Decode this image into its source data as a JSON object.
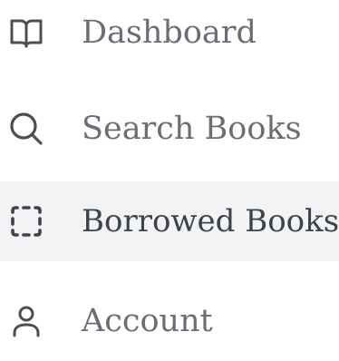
{
  "sidebar": {
    "items": [
      {
        "label": "Dashboard",
        "icon": "book-open-icon",
        "active": false
      },
      {
        "label": "Search Books",
        "icon": "search-icon",
        "active": false
      },
      {
        "label": "Borrowed Books",
        "icon": "dashed-square-icon",
        "active": true
      },
      {
        "label": "Account",
        "icon": "user-icon",
        "active": false
      }
    ]
  },
  "colors": {
    "active_background": "#f1f3f4",
    "text": "#6a6e74",
    "active_text": "#3f4347",
    "icon": "#4b4f55"
  }
}
